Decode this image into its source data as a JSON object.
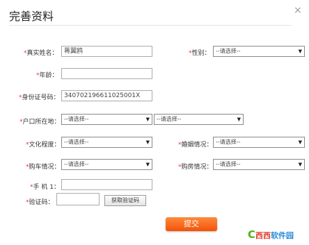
{
  "title": "完善资料",
  "close": "×",
  "fields": {
    "name_label": "真实姓名：",
    "name_value": "蒋翼鸥",
    "gender_label": "性别：",
    "gender_value": "--请选择--",
    "age_label": "年龄：",
    "age_value": "",
    "id_label": "身份证号码：",
    "id_value": "340702196611025001X",
    "hukou_label": "户口所在地：",
    "hukou_value1": "--请选择--",
    "hukou_value2": "--请选择--",
    "edu_label": "文化程度：",
    "edu_value": "--请选择--",
    "marriage_label": "婚姻情况：",
    "marriage_value": "--请选择--",
    "car_label": "购车情况：",
    "car_value": "--请选择--",
    "house_label": "购房情况：",
    "house_value": "--请选择--",
    "phone_label": "手 机 1：",
    "phone_value": "",
    "code_label": "验证码：",
    "code_value": ""
  },
  "required_mark": "*",
  "get_code_label": "获取验证码",
  "submit_label": "提交",
  "logo": {
    "c": "C",
    "a": "西西",
    "b": "软件园"
  }
}
